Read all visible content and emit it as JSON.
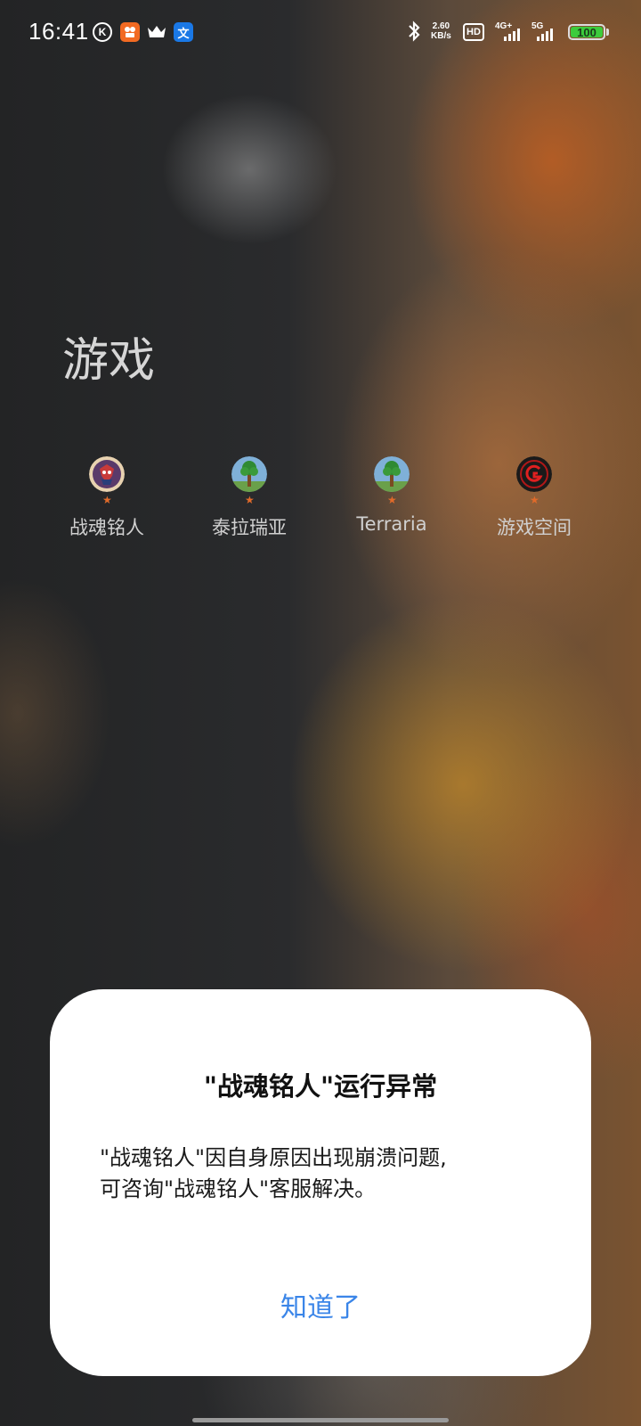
{
  "status_bar": {
    "time": "16:41",
    "k_badge": "K",
    "a_badge": "文",
    "speed_value": "2.60",
    "speed_unit": "KB/s",
    "hd_label": "HD",
    "sim1_label": "4G+",
    "sim2_label": "5G",
    "battery": "100",
    "notification_icons": [
      "k-circle-icon",
      "kuaishou-icon",
      "crown-icon",
      "translate-icon"
    ],
    "battery_color": "#3ccc3c"
  },
  "folder": {
    "title": "游戏",
    "apps": [
      {
        "label": "战魂铭人",
        "icon": "zhanhun-game-icon"
      },
      {
        "label": "泰拉瑞亚",
        "icon": "terraria-tree-icon"
      },
      {
        "label": "Terraria",
        "icon": "terraria-tree-icon"
      },
      {
        "label": "游戏空间",
        "icon": "game-space-icon"
      }
    ],
    "new_dot_color": "#e06a2a"
  },
  "dialog": {
    "title": "\"战魂铭人\"运行异常",
    "body_line1": "\"战魂铭人\"因自身原因出现崩溃问题,",
    "body_line2": "可咨询\"战魂铭人\"客服解决。",
    "button_label": "知道了",
    "button_color": "#3a85e8"
  }
}
